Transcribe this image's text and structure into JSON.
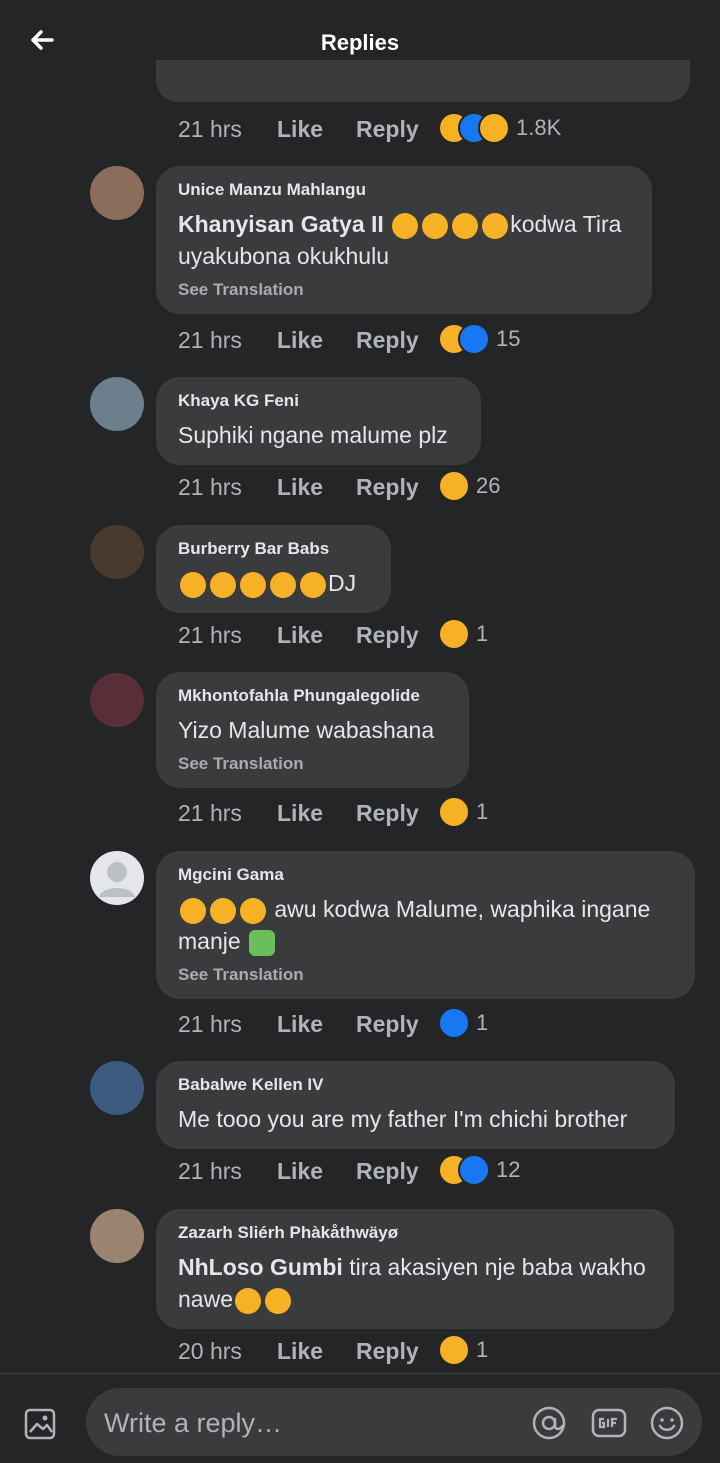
{
  "header": {
    "title": "Replies"
  },
  "top_item": {
    "time": "21 hrs",
    "like": "Like",
    "reply": "Reply",
    "reaction_count": "1.8K"
  },
  "comments": [
    {
      "author": "Unice Manzu Mahlangu",
      "mention": "Khanyisan Gatya II",
      "text_after": "kodwa Tira uyakubona okukhulu",
      "see_translation": "See Translation",
      "time": "21 hrs",
      "like": "Like",
      "reply": "Reply",
      "reaction_count": "15"
    },
    {
      "author": "Khaya KG Feni",
      "text": "Suphiki ngane malume plz",
      "time": "21 hrs",
      "like": "Like",
      "reply": "Reply",
      "reaction_count": "26"
    },
    {
      "author": "Burberry Bar Babs",
      "text": "DJ",
      "time": "21 hrs",
      "like": "Like",
      "reply": "Reply",
      "reaction_count": "1"
    },
    {
      "author": "Mkhontofahla Phungalegolide",
      "text": "Yizo Malume wabashana",
      "see_translation": "See Translation",
      "time": "21 hrs",
      "like": "Like",
      "reply": "Reply",
      "reaction_count": "1"
    },
    {
      "author": "Mgcini Gama",
      "text": "awu kodwa Malume, waphika ingane manje",
      "see_translation": "See Translation",
      "time": "21 hrs",
      "like": "Like",
      "reply": "Reply",
      "reaction_count": "1"
    },
    {
      "author": "Babalwe Kellen IV",
      "text": "Me tooo you are my father I'm chichi brother",
      "time": "21 hrs",
      "like": "Like",
      "reply": "Reply",
      "reaction_count": "12"
    },
    {
      "author": "Zazarh Sliérh Phàkåthwäyø",
      "mention": "NhLoso Gumbi",
      "text_after": "tira akasiyen nje baba wakho nawe",
      "time": "20 hrs",
      "like": "Like",
      "reply": "Reply",
      "reaction_count": "1"
    }
  ],
  "composer": {
    "placeholder": "Write a reply…"
  },
  "colors": {
    "background": "#242526",
    "bubble": "#3a3b3c",
    "haha": "#f7b125",
    "like": "#1877f2"
  }
}
